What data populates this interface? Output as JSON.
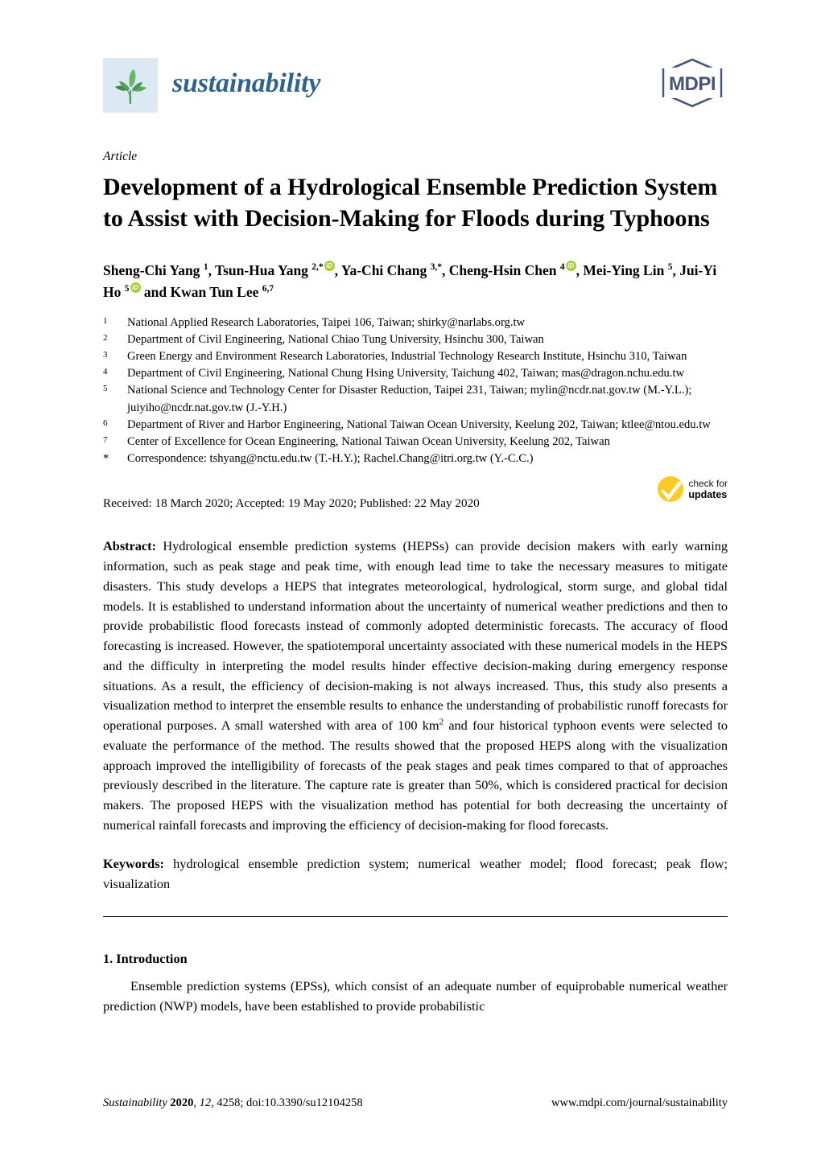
{
  "masthead": {
    "journal_name": "sustainability",
    "journal_logo_icon": "seedling-leaf-icon",
    "publisher_logo_text": "MDPI",
    "publisher_logo_icon": "mdpi-hexagon-logo",
    "brand_color": "#2e6390",
    "logo_bg_color": "#dce9f2",
    "leaf_color": "#4f9e59",
    "publisher_color": "#48547a"
  },
  "article": {
    "type": "Article",
    "title": "Development of a Hydrological Ensemble Prediction System to Assist with Decision-Making for Floods during Typhoons"
  },
  "authors": {
    "line1_parts": [
      {
        "name": "Sheng-Chi Yang",
        "sup": "1",
        "orcid": false,
        "sep": ", "
      },
      {
        "name": "Tsun-Hua Yang",
        "sup": "2,*",
        "orcid": true,
        "sep": ", "
      },
      {
        "name": "Ya-Chi Chang",
        "sup": "3,*",
        "orcid": false,
        "sep": ", "
      },
      {
        "name": "Cheng-Hsin Chen",
        "sup": "4",
        "orcid": true,
        "sep": ", "
      },
      {
        "name": "Mei-Ying Lin",
        "sup": "5",
        "orcid": false,
        "sep": ","
      }
    ],
    "line2_parts": [
      {
        "name": "Jui-Yi Ho",
        "sup": "5",
        "orcid": true,
        "sep": " and "
      },
      {
        "name": "Kwan Tun Lee",
        "sup": "6,7",
        "orcid": false,
        "sep": ""
      }
    ],
    "full_text": "Sheng-Chi Yang 1, Tsun-Hua Yang 2,*, Ya-Chi Chang 3,*, Cheng-Hsin Chen 4, Mei-Ying Lin 5, Jui-Yi Ho 5 and Kwan Tun Lee 6,7",
    "orcid_color": "#a6ce39"
  },
  "affiliations": [
    {
      "marker": "1",
      "text": "National Applied Research Laboratories, Taipei 106, Taiwan; shirky@narlabs.org.tw"
    },
    {
      "marker": "2",
      "text": "Department of Civil Engineering, National Chiao Tung University, Hsinchu 300, Taiwan"
    },
    {
      "marker": "3",
      "text": "Green Energy and Environment Research Laboratories, Industrial Technology Research Institute, Hsinchu 310, Taiwan"
    },
    {
      "marker": "4",
      "text": "Department of Civil Engineering, National Chung Hsing University, Taichung 402, Taiwan; mas@dragon.nchu.edu.tw"
    },
    {
      "marker": "5",
      "text": "National Science and Technology Center for Disaster Reduction, Taipei 231, Taiwan; mylin@ncdr.nat.gov.tw (M.-Y.L.); juiyiho@ncdr.nat.gov.tw (J.-Y.H.)"
    },
    {
      "marker": "6",
      "text": "Department of River and Harbor Engineering, National Taiwan Ocean University, Keelung 202, Taiwan; ktlee@ntou.edu.tw"
    },
    {
      "marker": "7",
      "text": "Center of Excellence for Ocean Engineering, National Taiwan Ocean University, Keelung 202, Taiwan"
    },
    {
      "marker": "*",
      "text": "Correspondence: tshyang@nctu.edu.tw (T.-H.Y.); Rachel.Chang@itri.org.tw (Y.-C.C.)"
    }
  ],
  "dates": {
    "line": "Received: 18 March 2020; Accepted: 19 May 2020; Published: 22 May 2020",
    "received": "18 March 2020",
    "accepted": "19 May 2020",
    "published": "22 May 2020"
  },
  "check_updates": {
    "line1": "check for",
    "line2": "updates",
    "icon": "yellow-checkmark-circle-icon",
    "color": "#ffc928"
  },
  "abstract": {
    "label": "Abstract:",
    "part1": " Hydrological ensemble prediction systems (HEPSs) can provide decision makers with early warning information, such as peak stage and peak time, with enough lead time to take the necessary measures to mitigate disasters. This study develops a HEPS that integrates meteorological, hydrological, storm surge, and global tidal models. It is established to understand information about the uncertainty of numerical weather predictions and then to provide probabilistic flood forecasts instead of commonly adopted deterministic forecasts. The accuracy of flood forecasting is increased. However, the spatiotemporal uncertainty associated with these numerical models in the HEPS and the difficulty in interpreting the model results hinder effective decision-making during emergency response situations. As a result, the efficiency of decision-making is not always increased. Thus, this study also presents a visualization method to interpret the ensemble results to enhance the understanding of probabilistic runoff forecasts for operational purposes. A small watershed with area of 100 km",
    "sup": "2",
    "part2": " and four historical typhoon events were selected to evaluate the performance of the method. The results showed that the proposed HEPS along with the visualization approach improved the intelligibility of forecasts of the peak stages and peak times compared to that of approaches previously described in the literature. The capture rate is greater than 50%, which is considered practical for decision makers. The proposed HEPS with the visualization method has potential for both decreasing the uncertainty of numerical rainfall forecasts and improving the efficiency of decision-making for flood forecasts."
  },
  "keywords": {
    "label": "Keywords:",
    "text": " hydrological ensemble prediction system; numerical weather model; flood forecast; peak flow; visualization",
    "list": [
      "hydrological ensemble prediction system",
      "numerical weather model",
      "flood forecast",
      "peak flow",
      "visualization"
    ]
  },
  "body": {
    "section_number_title": "1. Introduction",
    "paragraph1": "Ensemble prediction systems (EPSs), which consist of an adequate number of equiprobable numerical weather prediction (NWP) models, have been established to provide probabilistic"
  },
  "footer": {
    "journal": "Sustainability",
    "year": "2020",
    "volume": "12",
    "article_number": "4258",
    "doi": "doi:10.3390/su12104258",
    "left_full": "Sustainability 2020, 12, 4258; doi:10.3390/su12104258",
    "right": "www.mdpi.com/journal/sustainability"
  }
}
